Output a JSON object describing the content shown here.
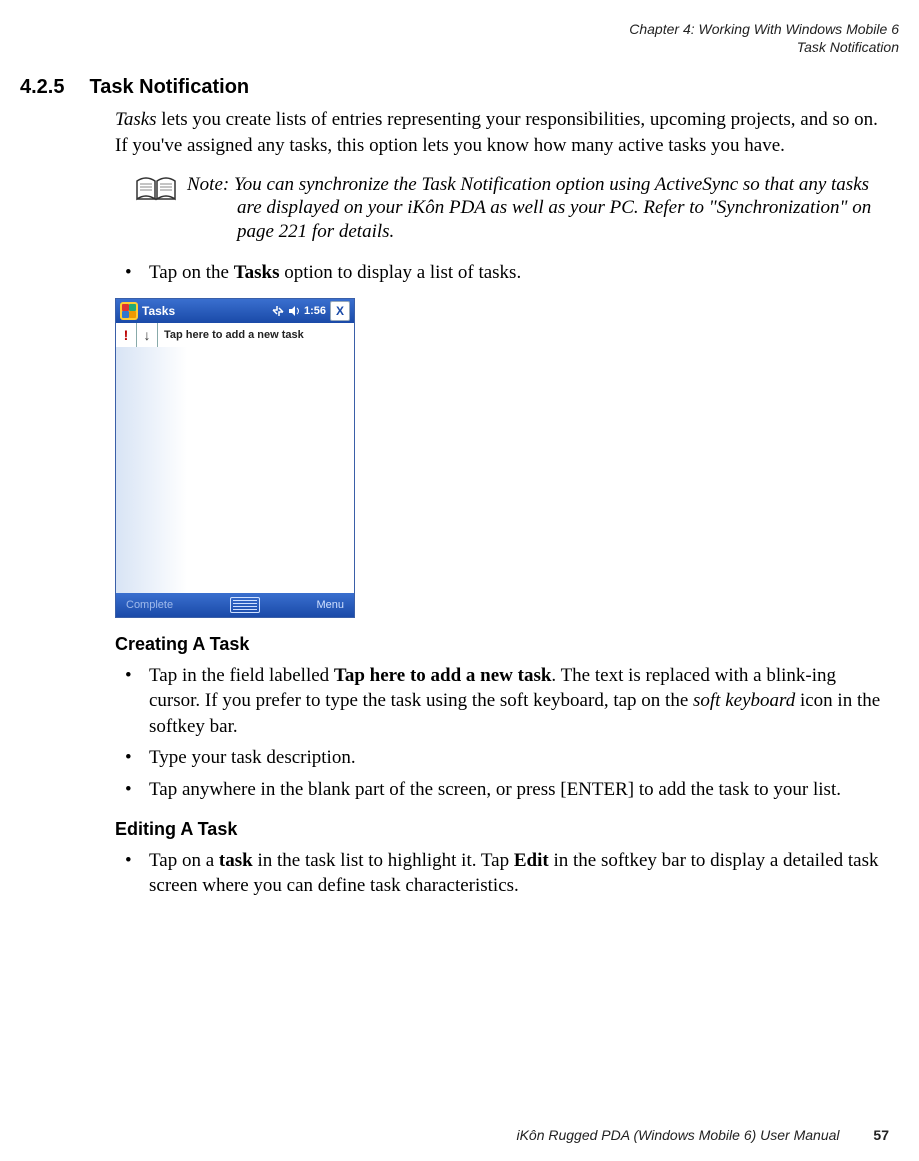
{
  "header": {
    "chapter_line": "Chapter 4: Working With Windows Mobile 6",
    "section_line": "Task Notification"
  },
  "section": {
    "number": "4.2.5",
    "title": "Task Notification"
  },
  "intro": {
    "tasks_word": "Tasks",
    "rest": " lets you create lists of entries representing your responsibilities, upcoming projects, and so on. If you've assigned any tasks, this option lets you know how many active tasks you have."
  },
  "note": {
    "prefix": "Note:",
    "body1": " You can synchronize the Task Notification option using ActiveSync so that any tasks",
    "body2": "are displayed on your iKôn PDA as well as your PC. Refer to \"Synchronization\" on page 221 for details."
  },
  "bullet1": {
    "pre": "Tap on the ",
    "bold": "Tasks",
    "post": " option to display a list of tasks."
  },
  "screenshot": {
    "title": "Tasks",
    "time": "1:56",
    "add_placeholder": "Tap here to add a new task",
    "soft_left": "Complete",
    "soft_right": "Menu",
    "priority_label": "!",
    "sort_label": "↓",
    "close_label": "X"
  },
  "creating": {
    "heading": "Creating A Task",
    "b1_pre": "Tap in the field labelled ",
    "b1_bold": "Tap here to add a new task",
    "b1_mid": ". The text is replaced with a blink-ing cursor. If you prefer to type the task using the soft keyboard, tap on the ",
    "b1_ital": "soft keyboard",
    "b1_post": " icon in the softkey bar.",
    "b2": "Type your task description.",
    "b3": "Tap anywhere in the blank part of the screen, or press [ENTER] to add the task to your list."
  },
  "editing": {
    "heading": "Editing A Task",
    "pre": "Tap on a ",
    "bold1": "task",
    "mid": " in the task list to highlight it. Tap ",
    "bold2": "Edit",
    "post": " in the softkey bar to display a detailed task screen where you can define task characteristics."
  },
  "footer": {
    "manual": "iKôn Rugged PDA (Windows Mobile 6) User Manual",
    "page": "57"
  }
}
